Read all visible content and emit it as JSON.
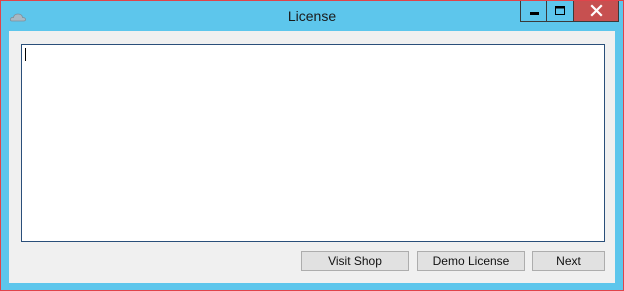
{
  "window": {
    "title": "License",
    "icon": "cloud-icon",
    "controls": [
      "minimize-icon",
      "maximize-icon",
      "close-icon"
    ],
    "colors": {
      "titlebar": "#5dc6ec",
      "close_button": "#c75050",
      "border": "#e0444a",
      "client_bg": "#f0f0f0",
      "textbox_border": "#2a4f7a"
    }
  },
  "license_box": {
    "value": ""
  },
  "buttons": {
    "visit_shop": "Visit Shop",
    "demo_license": "Demo License",
    "next": "Next"
  }
}
